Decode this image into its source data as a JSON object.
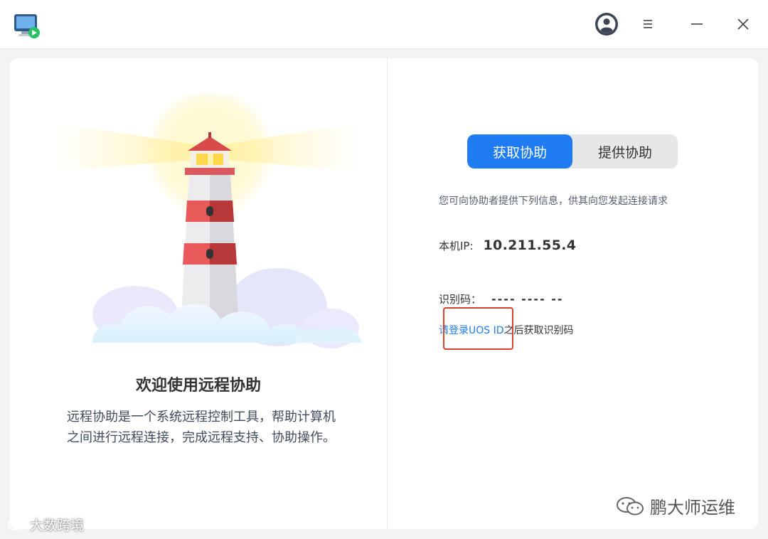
{
  "titlebar": {
    "icons": {
      "app": "remote-desktop-icon",
      "avatar": "user-avatar-icon",
      "menu": "hamburger-menu-icon",
      "minimize": "minimize-icon",
      "close": "close-icon"
    }
  },
  "welcome": {
    "title": "欢迎使用远程协助",
    "description": "远程协助是一个系统远程控制工具，帮助计算机之间进行远程连接，完成远程支持、协助操作。"
  },
  "tabs": [
    {
      "label": "获取协助",
      "active": true
    },
    {
      "label": "提供协助",
      "active": false
    }
  ],
  "info_text": "您可向协助者提供下列信息，供其向您发起连接请求",
  "ip": {
    "label": "本机IP:",
    "value": "10.211.55.4"
  },
  "code": {
    "label": "识别码：",
    "value": "---- ---- --"
  },
  "login_hint": {
    "prefix": "请",
    "link": "登录UOS ID",
    "suffix": "之后获取识别码"
  },
  "watermarks": {
    "left": "大数跨境",
    "right": "鹏大师运维"
  },
  "colors": {
    "accent": "#1f7cf2",
    "highlight": "#d9412c"
  }
}
